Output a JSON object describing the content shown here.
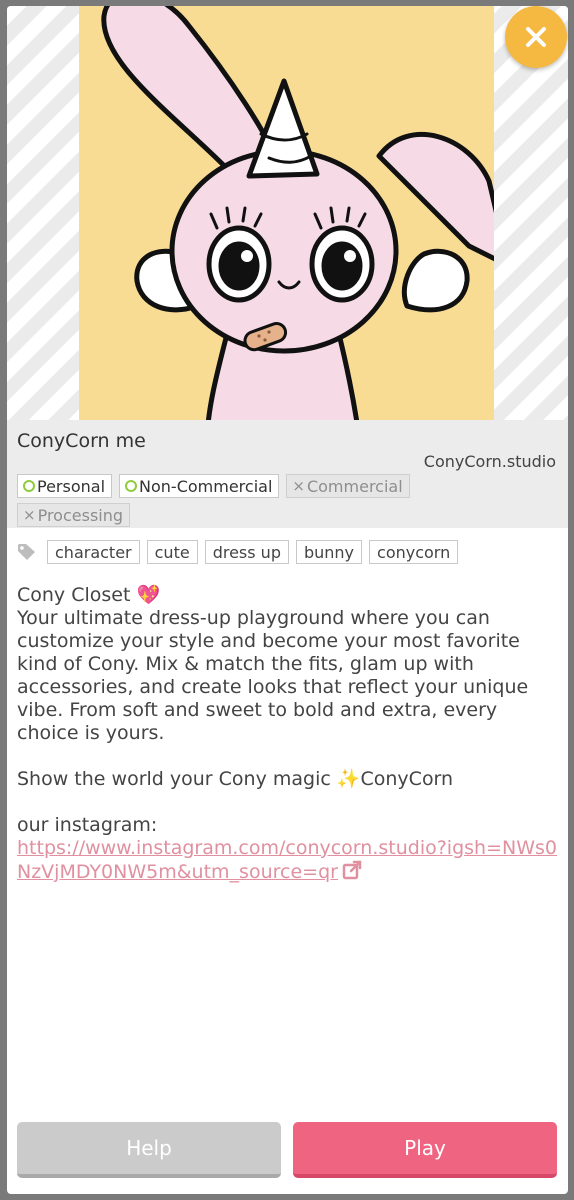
{
  "close": {
    "icon": "close-icon"
  },
  "item": {
    "title": "ConyCorn me",
    "author": "ConyCorn.studio"
  },
  "licenses": [
    {
      "label": "Personal",
      "allowed": true
    },
    {
      "label": "Non-Commercial",
      "allowed": true
    },
    {
      "label": "Commercial",
      "allowed": false
    },
    {
      "label": "Processing",
      "allowed": false
    }
  ],
  "license_marks": {
    "allowed_icon": "circle-icon",
    "denied_mark": "×"
  },
  "tags": {
    "icon": "tag-icon",
    "items": [
      "character",
      "cute",
      "dress up",
      "bunny",
      "conycorn"
    ]
  },
  "description": {
    "line1": "Cony Closet 💖",
    "line2": "Your ultimate dress-up playground where you can customize your style and become your most favorite kind of Cony. Mix & match the fits, glam up with accessories, and create looks that reflect your unique vibe. From soft and sweet to bold and extra, every choice is yours.",
    "line3": "Show the world your Cony magic ✨ConyCorn",
    "line4": "our instagram:",
    "link": "https://www.instagram.com/conycorn.studio?igsh=NWs0NzVjMDY0NW5m&utm_source=qr",
    "link_icon": "external-link-icon"
  },
  "buttons": {
    "help": "Help",
    "play": "Play"
  },
  "colors": {
    "accent_pink": "#ef6481",
    "close_orange": "#f5b942",
    "thumbnail_bg": "#f8dc94",
    "allowed_green": "#8fcc3c",
    "link_pink": "#e0909f"
  }
}
